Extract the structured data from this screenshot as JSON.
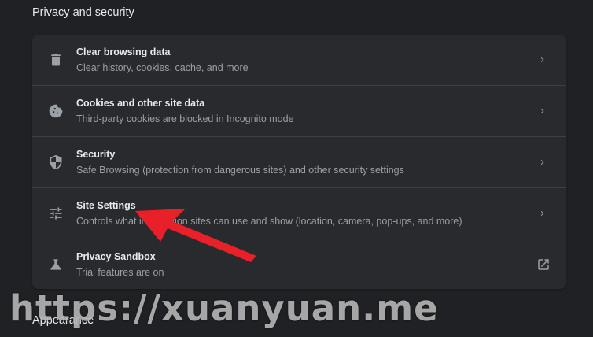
{
  "section": {
    "title": "Privacy and security"
  },
  "rows": [
    {
      "title": "Clear browsing data",
      "subtitle": "Clear history, cookies, cache, and more",
      "icon": "trash-icon",
      "action": "chevron-right-icon"
    },
    {
      "title": "Cookies and other site data",
      "subtitle": "Third-party cookies are blocked in Incognito mode",
      "icon": "cookie-icon",
      "action": "chevron-right-icon"
    },
    {
      "title": "Security",
      "subtitle": "Safe Browsing (protection from dangerous sites) and other security settings",
      "icon": "shield-icon",
      "action": "chevron-right-icon"
    },
    {
      "title": "Site Settings",
      "subtitle": "Controls what information sites can use and show (location, camera, pop-ups, and more)",
      "icon": "tune-sliders-icon",
      "action": "chevron-right-icon"
    },
    {
      "title": "Privacy Sandbox",
      "subtitle": "Trial features are on",
      "icon": "flask-icon",
      "action": "open-external-icon"
    }
  ],
  "next_section": {
    "title": "Appearance"
  },
  "watermark": "https://xuanyuan.me",
  "colors": {
    "background": "#202124",
    "card": "#292a2d",
    "text_primary": "#e8eaed",
    "text_secondary": "#9aa0a6",
    "annotation_arrow": "#e8202a"
  }
}
